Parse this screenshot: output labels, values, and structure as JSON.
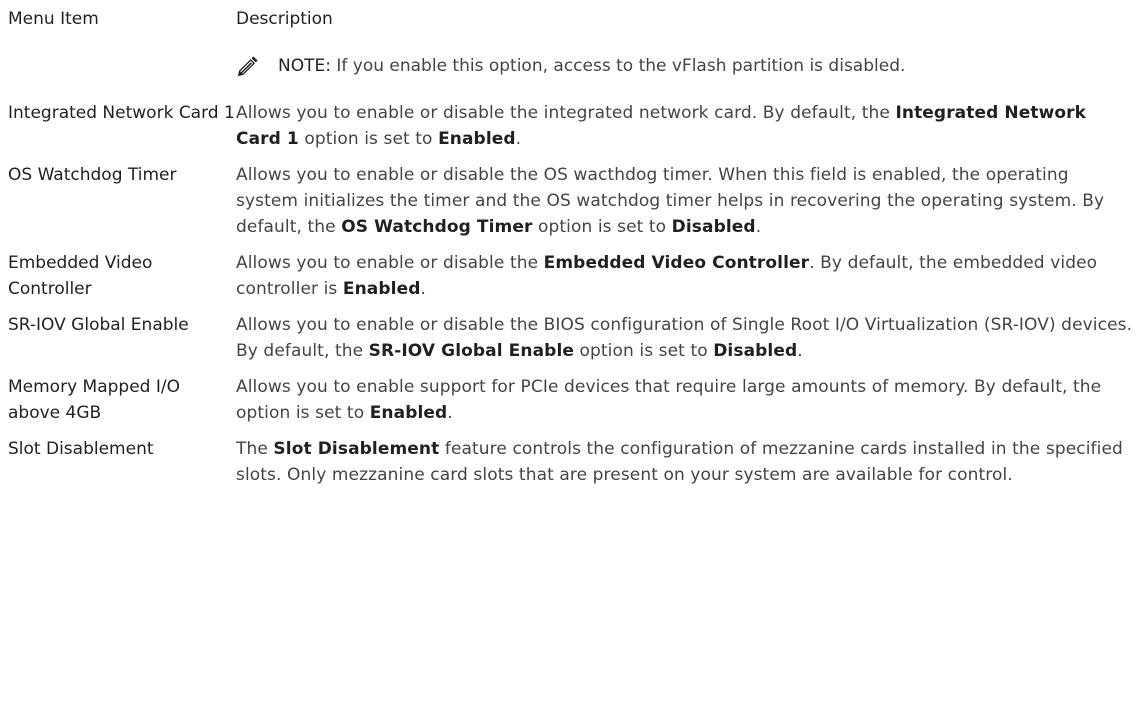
{
  "header": {
    "menu_item": "Menu Item",
    "description": "Description"
  },
  "note": {
    "label": "NOTE:",
    "text": " If you enable this option, access to the vFlash partition is disabled.",
    "icon": "pencil-note-icon"
  },
  "rows": [
    {
      "item": "Integrated Network Card 1",
      "desc": [
        {
          "t": "Allows you to enable or disable the integrated network card. By default, the "
        },
        {
          "t": "Integrated Network Card 1",
          "b": true
        },
        {
          "t": " option is set to "
        },
        {
          "t": "Enabled",
          "b": true
        },
        {
          "t": "."
        }
      ]
    },
    {
      "item": "OS Watchdog Timer",
      "desc": [
        {
          "t": "Allows you to enable or disable the OS wacthdog timer. When this field is enabled, the operating system initializes the timer and the OS watchdog timer helps in recovering the operating system. By default, the "
        },
        {
          "t": "OS Watchdog Timer",
          "b": true
        },
        {
          "t": " option is set to "
        },
        {
          "t": "Disabled",
          "b": true
        },
        {
          "t": "."
        }
      ]
    },
    {
      "item": "Embedded Video Controller",
      "desc": [
        {
          "t": "Allows you to enable or disable the "
        },
        {
          "t": "Embedded Video Controller",
          "b": true
        },
        {
          "t": ". By default, the embedded video controller is "
        },
        {
          "t": "Enabled",
          "b": true
        },
        {
          "t": "."
        }
      ]
    },
    {
      "item": "SR-IOV Global Enable",
      "desc": [
        {
          "t": "Allows you to enable or disable the BIOS configuration of Single Root I/O Virtualization (SR-IOV) devices. By default, the "
        },
        {
          "t": "SR-IOV Global Enable",
          "b": true
        },
        {
          "t": " option is set to "
        },
        {
          "t": "Disabled",
          "b": true
        },
        {
          "t": "."
        }
      ]
    },
    {
      "item": "Memory Mapped I/O above 4GB",
      "desc": [
        {
          "t": "Allows you to enable support for PCIe devices that require large amounts of memory. By default, the option is set to "
        },
        {
          "t": "Enabled",
          "b": true
        },
        {
          "t": "."
        }
      ]
    },
    {
      "item": "Slot Disablement",
      "desc": [
        {
          "t": "The "
        },
        {
          "t": "Slot Disablement",
          "b": true
        },
        {
          "t": " feature controls the configuration of mezzanine cards installed in the specified slots. Only mezzanine card slots that are present on your system are available for control."
        }
      ]
    }
  ]
}
